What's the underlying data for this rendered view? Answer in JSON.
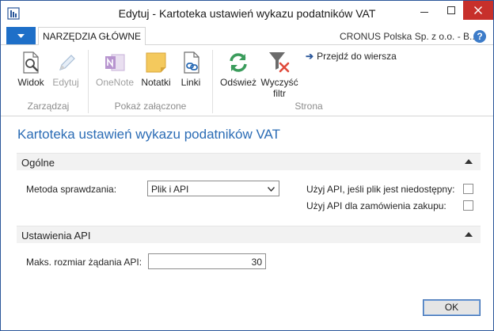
{
  "window": {
    "title": "Edytuj - Kartoteka ustawień wykazu podatników VAT"
  },
  "ribbon": {
    "tab_active": "NARZĘDZIA GŁÓWNE",
    "company": "CRONUS Polska Sp. z o.o. - B...",
    "groups": {
      "manage": "Zarządzaj",
      "attachments": "Pokaż załączone",
      "page": "Strona"
    },
    "buttons": {
      "view": "Widok",
      "edit": "Edytuj",
      "onenote": "OneNote",
      "notes": "Notatki",
      "links": "Linki",
      "refresh": "Odśwież",
      "clear_filter_line1": "Wyczyść",
      "clear_filter_line2": "filtr",
      "goto_row": "Przejdź do wiersza"
    }
  },
  "page": {
    "title": "Kartoteka ustawień wykazu podatników VAT"
  },
  "general": {
    "header": "Ogólne",
    "method_label": "Metoda sprawdzania:",
    "method_value": "Plik i API",
    "use_api_label": "Użyj API, jeśli plik jest niedostępny:",
    "use_api_checked": false,
    "use_api_purchase_label": "Użyj API dla zamówienia zakupu:",
    "use_api_purchase_checked": false
  },
  "api_settings": {
    "header": "Ustawienia API",
    "max_request_label": "Maks. rozmiar żądania API:",
    "max_request_value": "30"
  },
  "footer": {
    "ok_label": "OK"
  },
  "colors": {
    "accent": "#2b6cb5",
    "title_bar_border": "#2b579a",
    "close_button": "#c7302b",
    "app_menu": "#1e6fc8"
  }
}
